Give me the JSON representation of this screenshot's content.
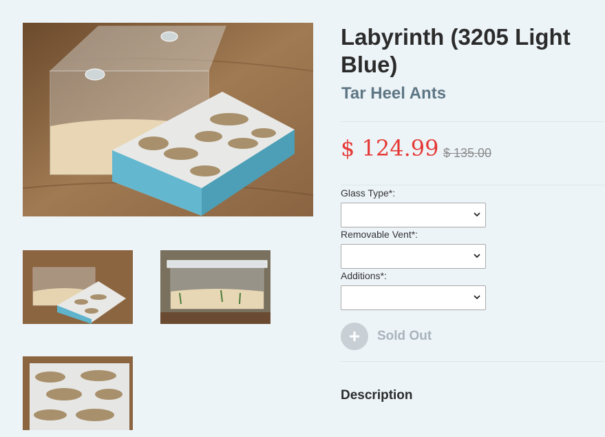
{
  "product": {
    "title": "Labyrinth (3205 Light Blue)",
    "brand": "Tar Heel Ants",
    "price": "$ 124.99",
    "compare_price": "$ 135.00"
  },
  "gallery": {
    "main_image": "ant-formicarium-photo",
    "thumbnails": [
      "formicarium-angle-photo",
      "formicarium-side-photo",
      "formicarium-top-photo"
    ]
  },
  "options": [
    {
      "label": "Glass Type*:",
      "value": ""
    },
    {
      "label": "Removable Vent*:",
      "value": ""
    },
    {
      "label": "Additions*:",
      "value": ""
    }
  ],
  "cart": {
    "button_label": "Sold Out",
    "icon": "plus-icon"
  },
  "description": {
    "heading": "Description"
  },
  "colors": {
    "price": "#e53935",
    "brand": "#5e7684",
    "sold_out": "#a8b4bc",
    "background": "#edf4f8"
  }
}
